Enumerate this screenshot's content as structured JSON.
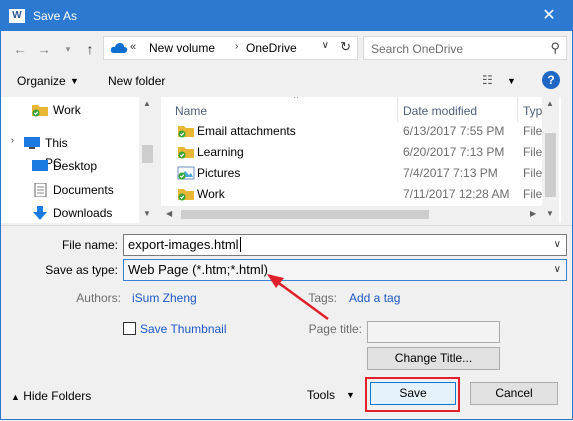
{
  "window": {
    "title": "Save As",
    "app_icon": "W"
  },
  "address": {
    "chevrons": "«",
    "crumbs": [
      "New volume",
      "OneDrive"
    ]
  },
  "search": {
    "placeholder": "Search OneDrive"
  },
  "toolbar": {
    "organize": "Organize",
    "new_folder": "New folder",
    "help": "?"
  },
  "nav": {
    "items": [
      "Work",
      "This PC",
      "Desktop",
      "Documents",
      "Downloads"
    ]
  },
  "columns": {
    "name": "Name",
    "date": "Date modified",
    "type": "Type"
  },
  "files": [
    {
      "name": "Email attachments",
      "date": "6/13/2017 7:55 PM",
      "type": "File fol"
    },
    {
      "name": "Learning",
      "date": "6/20/2017 7:13 PM",
      "type": "File fol"
    },
    {
      "name": "Pictures",
      "date": "7/4/2017 7:13 PM",
      "type": "File fol"
    },
    {
      "name": "Work",
      "date": "7/11/2017 12:28 AM",
      "type": "File fol"
    }
  ],
  "form": {
    "file_name_label": "File name:",
    "file_name": "export-images.html",
    "save_type_label": "Save as type:",
    "save_type": "Web Page (*.htm;*.html)",
    "authors_label": "Authors:",
    "authors": "iSum Zheng",
    "tags_label": "Tags:",
    "tags": "Add a tag",
    "save_thumbnail": "Save Thumbnail",
    "page_title_label": "Page title:",
    "change_title": "Change Title..."
  },
  "footer": {
    "hide_folders": "Hide Folders",
    "tools": "Tools",
    "save": "Save",
    "cancel": "Cancel"
  },
  "colors": {
    "titlebar": "#2b79d0",
    "annotation": "#e0202a",
    "link": "#1d58c6"
  }
}
